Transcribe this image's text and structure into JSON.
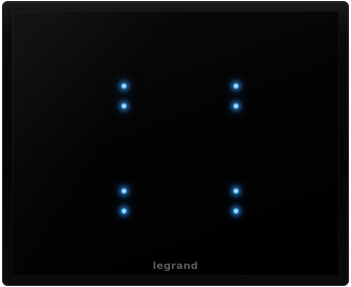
{
  "brand": {
    "logo_text": "legrand"
  },
  "colors": {
    "led_glow": "#3aa0ff",
    "panel": "#050505",
    "logo": "#5a5a5a"
  },
  "keys": [
    {
      "position": "top-left",
      "leds": 2
    },
    {
      "position": "top-right",
      "leds": 2
    },
    {
      "position": "bottom-left",
      "leds": 2
    },
    {
      "position": "bottom-right",
      "leds": 2
    }
  ]
}
